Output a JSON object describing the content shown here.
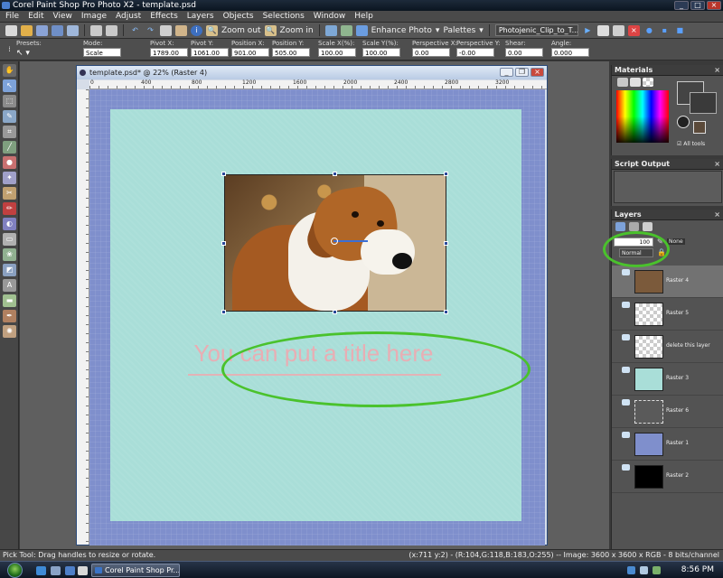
{
  "window": {
    "title": "Corel Paint Shop Pro Photo X2 - template.psd"
  },
  "menu": [
    "File",
    "Edit",
    "View",
    "Image",
    "Adjust",
    "Effects",
    "Layers",
    "Objects",
    "Selections",
    "Window",
    "Help"
  ],
  "toolbar": {
    "zoom_out": "Zoom out",
    "zoom_in": "Zoom in",
    "enhance_photo": "Enhance Photo",
    "palettes": "Palettes",
    "script_select": "Photojenic_Clip_to_T..."
  },
  "tool_options": [
    {
      "label": "Presets:",
      "value": ""
    },
    {
      "label": "Mode:",
      "value": "Scale"
    },
    {
      "label": "Pivot X:",
      "value": "1789.00"
    },
    {
      "label": "Pivot Y:",
      "value": "1061.00"
    },
    {
      "label": "Position X:",
      "value": "901.00"
    },
    {
      "label": "Position Y:",
      "value": "505.00"
    },
    {
      "label": "Scale X(%):",
      "value": "100.00"
    },
    {
      "label": "Scale Y(%):",
      "value": "100.00"
    },
    {
      "label": "Perspective X:",
      "value": "0.00"
    },
    {
      "label": "Perspective Y:",
      "value": "-0.00"
    },
    {
      "label": "Shear:",
      "value": "0.00"
    },
    {
      "label": "Angle:",
      "value": "0.000"
    }
  ],
  "document": {
    "title": "template.psd* @  22% (Raster 4)",
    "ruler_labels": [
      "0",
      "400",
      "800",
      "1200",
      "1600",
      "2000",
      "2400",
      "2800",
      "3200"
    ]
  },
  "canvas": {
    "title_text": "You can put a title here"
  },
  "materials": {
    "header": "Materials",
    "all_tools_label": "All tools"
  },
  "script_output": {
    "header": "Script Output"
  },
  "layers": {
    "header": "Layers",
    "opacity": "100",
    "blend_mode": "Normal",
    "mask_label": "None",
    "items": [
      {
        "name": "Raster 4",
        "thumb": "photo"
      },
      {
        "name": "Raster 5",
        "thumb": "checker"
      },
      {
        "name": "delete this layer",
        "thumb": "checker"
      },
      {
        "name": "Raster 3",
        "thumb": "mint"
      },
      {
        "name": "Raster 6",
        "thumb": "checker-dashed"
      },
      {
        "name": "Raster 1",
        "thumb": "blue"
      },
      {
        "name": "Raster 2",
        "thumb": "black"
      }
    ]
  },
  "status": {
    "left": "Pick Tool: Drag handles to resize or rotate.",
    "right": "(x:711 y:2) - (R:104,G:118,B:183,O:255) -- Image: 3600 x 3600 x RGB - 8 bits/channel"
  },
  "taskbar": {
    "task_label": "Corel Paint Shop Pr...",
    "clock": "8:56 PM"
  },
  "colors": {
    "accent_green": "#4ac22c",
    "canvas_border": "#7f8fcc",
    "paper": "#a9ded8",
    "title_pink": "#e8aeb4"
  }
}
